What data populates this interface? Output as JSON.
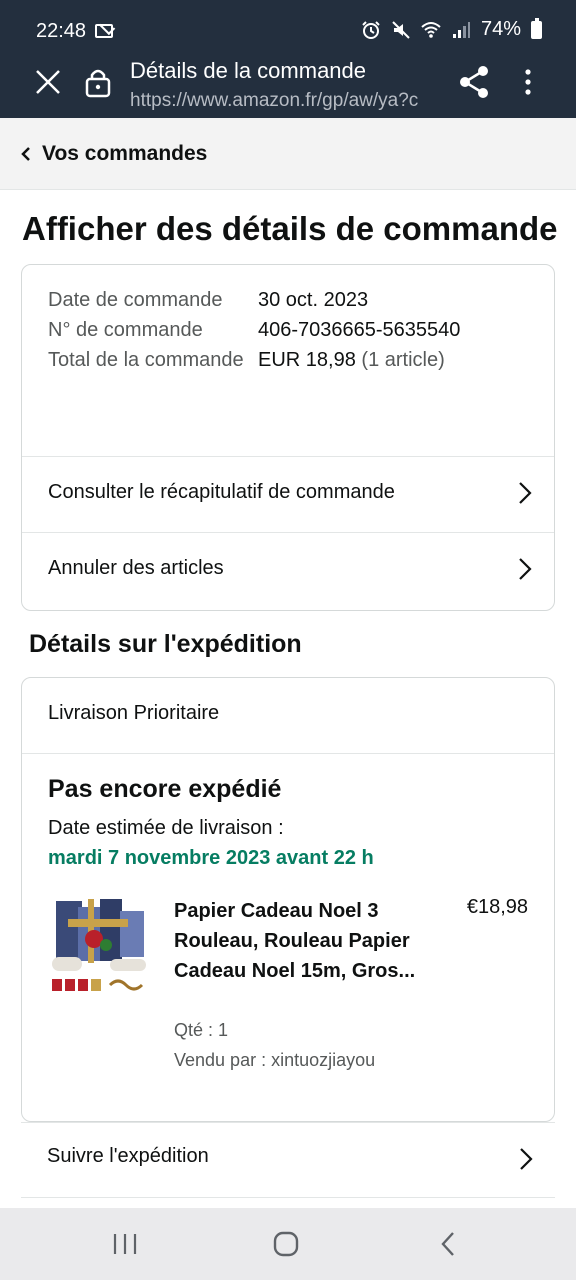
{
  "status_bar": {
    "time": "22:48",
    "battery": "74%"
  },
  "browser": {
    "page_title": "Détails de la commande",
    "url": "https://www.amazon.fr/gp/aw/ya?c"
  },
  "nav": {
    "back_label": "Vos commandes"
  },
  "page": {
    "title": "Afficher des détails de commande"
  },
  "order": {
    "date_label": "Date de commande",
    "date_value": "30 oct. 2023",
    "number_label": "N° de commande",
    "number_value": "406-7036665-5635540",
    "total_label": "Total de la commande",
    "total_value": "EUR 18,98",
    "total_items": "(1 article)",
    "summary_link": "Consulter le récapitulatif de commande",
    "cancel_link": "Annuler des articles"
  },
  "shipment": {
    "section_title": "Détails sur l'expédition",
    "method": "Livraison Prioritaire",
    "status": "Pas encore expédié",
    "estimate_label": "Date estimée de livraison :",
    "estimate_date": "mardi 7 novembre 2023 avant 22 h",
    "product": {
      "title": "Papier Cadeau Noel 3 Rouleau, Rouleau Papier Cadeau Noel 15m, Gros...",
      "price": "€18,98",
      "qty": "Qté : 1",
      "seller": "Vendu par : xintuozjiayou"
    },
    "track_link": "Suivre l'expédition"
  },
  "colors": {
    "chrome_bg": "#232f3e",
    "delivery_green": "#067d62",
    "text_primary": "#0f1111",
    "text_secondary": "#565959"
  },
  "icons": {
    "close": "close-icon",
    "lock": "lock-icon",
    "share": "share-icon",
    "menu": "more-vert-icon",
    "chevron_left": "chevron-left-icon",
    "chevron_right": "chevron-right-icon",
    "nav_recent": "recent-apps-icon",
    "nav_home": "home-icon",
    "nav_back": "back-icon"
  }
}
